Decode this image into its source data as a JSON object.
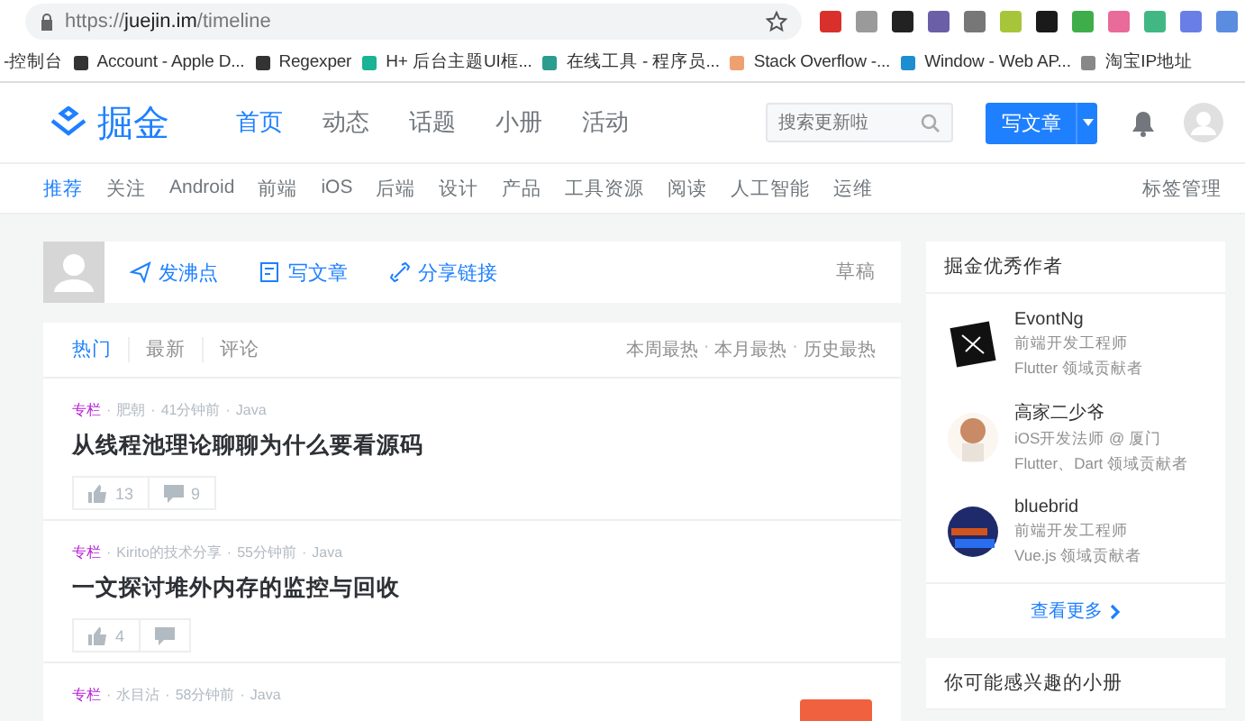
{
  "browser": {
    "url_scheme": "https://",
    "url_host": "juejin.im",
    "url_path": "/timeline"
  },
  "bookmarks": [
    {
      "title": "-控制台"
    },
    {
      "title": "Account - Apple D..."
    },
    {
      "title": "Regexper"
    },
    {
      "title": "H+ 后台主题UI框..."
    },
    {
      "title": "在线工具 - 程序员..."
    },
    {
      "title": "Stack Overflow -..."
    },
    {
      "title": "Window - Web AP..."
    },
    {
      "title": "淘宝IP地址"
    }
  ],
  "header": {
    "logo_text": "掘金",
    "nav": [
      {
        "label": "首页",
        "selected": true
      },
      {
        "label": "动态",
        "selected": false
      },
      {
        "label": "话题",
        "selected": false
      },
      {
        "label": "小册",
        "selected": false
      },
      {
        "label": "活动",
        "selected": false
      }
    ],
    "search": {
      "placeholder": "搜索更新啦"
    },
    "write_button": "写文章"
  },
  "tags": {
    "items": [
      {
        "label": "推荐",
        "selected": true
      },
      {
        "label": "关注",
        "selected": false
      },
      {
        "label": "Android",
        "selected": false
      },
      {
        "label": "前端",
        "selected": false
      },
      {
        "label": "iOS",
        "selected": false
      },
      {
        "label": "后端",
        "selected": false
      },
      {
        "label": "设计",
        "selected": false
      },
      {
        "label": "产品",
        "selected": false
      },
      {
        "label": "工具资源",
        "selected": false
      },
      {
        "label": "阅读",
        "selected": false
      },
      {
        "label": "人工智能",
        "selected": false
      },
      {
        "label": "运维",
        "selected": false
      }
    ],
    "manage": "标签管理"
  },
  "composer": {
    "actions": [
      {
        "kind": "pin",
        "label": "发沸点"
      },
      {
        "kind": "edit",
        "label": "写文章"
      },
      {
        "kind": "link",
        "label": "分享链接"
      }
    ],
    "drafts": "草稿"
  },
  "feed": {
    "tabs": [
      {
        "label": "热门",
        "selected": true
      },
      {
        "label": "最新",
        "selected": false
      },
      {
        "label": "评论",
        "selected": false
      }
    ],
    "ranges": [
      "本周最热",
      "本月最热",
      "历史最热"
    ],
    "separator": "·",
    "articles": [
      {
        "tag": "专栏",
        "author": "肥朝",
        "time": "41分钟前",
        "category": "Java",
        "title": "从线程池理论聊聊为什么要看源码",
        "likes": "13",
        "comments": "9"
      },
      {
        "tag": "专栏",
        "author": "Kirito的技术分享",
        "time": "55分钟前",
        "category": "Java",
        "title": "一文探讨堆外内存的监控与回收",
        "likes": "4"
      },
      {
        "tag": "专栏",
        "author": "水目沾",
        "time": "58分钟前",
        "category": "Java"
      }
    ]
  },
  "sidebar": {
    "authors_title": "掘金优秀作者",
    "authors": [
      {
        "name": "EvontNg",
        "job": "前端开发工程师",
        "badge": "Flutter 领域贡献者"
      },
      {
        "name": "高家二少爷",
        "job": "iOS开发法师 @ 厦门",
        "badge": "Flutter、Dart 领域贡献者"
      },
      {
        "name": "bluebrid",
        "job": "前端开发工程师",
        "badge": "Vue.js 领域贡献者"
      }
    ],
    "more": "查看更多",
    "books_title": "你可能感兴趣的小册"
  }
}
